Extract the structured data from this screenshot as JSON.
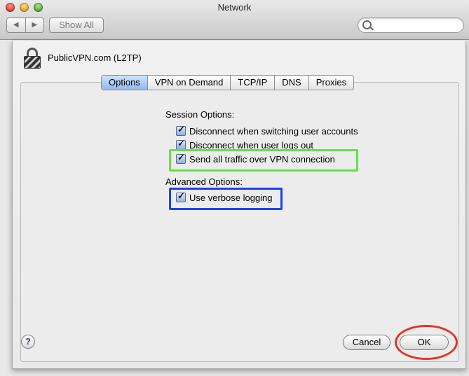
{
  "window": {
    "title": "Network",
    "nav_back": "◀",
    "nav_forward": "▶",
    "show_all_label": "Show All",
    "search_placeholder": ""
  },
  "sheet": {
    "connection_title": "PublicVPN.com (L2TP)",
    "tabs": [
      {
        "label": "Options",
        "active": true
      },
      {
        "label": "VPN on Demand",
        "active": false
      },
      {
        "label": "TCP/IP",
        "active": false
      },
      {
        "label": "DNS",
        "active": false
      },
      {
        "label": "Proxies",
        "active": false
      }
    ],
    "session_options_label": "Session Options:",
    "session_options": [
      {
        "label": "Disconnect when switching user accounts",
        "checked": true
      },
      {
        "label": "Disconnect when user logs out",
        "checked": true
      },
      {
        "label": "Send all traffic over VPN connection",
        "checked": true
      }
    ],
    "advanced_options_label": "Advanced Options:",
    "advanced_options": [
      {
        "label": "Use verbose logging",
        "checked": true
      }
    ],
    "help_label": "?",
    "cancel_label": "Cancel",
    "ok_label": "OK"
  },
  "colors": {
    "highlight_green": "#66e04a",
    "highlight_blue": "#1a43f0",
    "highlight_red": "#e5342a",
    "active_tab": "#8fb9ef"
  }
}
